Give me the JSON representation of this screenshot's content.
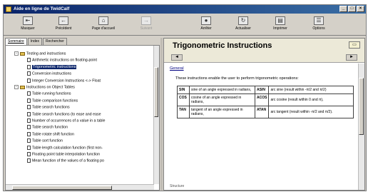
{
  "window": {
    "title": "Aide en ligne de TwidCalf"
  },
  "toolbar": [
    {
      "label": "Masquer",
      "icon": "hide-icon",
      "disabled": false
    },
    {
      "label": "Précédent",
      "icon": "back-icon",
      "disabled": false
    },
    {
      "label": "Page d'accueil",
      "icon": "home-icon",
      "disabled": false
    },
    {
      "label": "Suivant",
      "icon": "forward-icon",
      "disabled": true
    },
    {
      "label": "Arrêter",
      "icon": "stop-icon",
      "disabled": false
    },
    {
      "label": "Actualiser",
      "icon": "refresh-icon",
      "disabled": false
    },
    {
      "label": "Imprimer",
      "icon": "print-icon",
      "disabled": false
    },
    {
      "label": "Options",
      "icon": "options-icon",
      "disabled": false
    }
  ],
  "tabs": [
    "Sommaire",
    "Index",
    "Rechercher"
  ],
  "tree": [
    {
      "level": 0,
      "type": "book",
      "text": "Testing and instructions",
      "expander": "-"
    },
    {
      "level": 1,
      "type": "page",
      "text": "Arithmetic instructions on floating-point"
    },
    {
      "level": 1,
      "type": "page",
      "text": "Trigonometric instructions",
      "selected": true
    },
    {
      "level": 1,
      "type": "page",
      "text": "Conversion instructions"
    },
    {
      "level": 1,
      "type": "page",
      "text": "Integer Conversion Instructions <-> Float"
    },
    {
      "level": 0,
      "type": "book",
      "text": "Instructions on Object Tables",
      "expander": "-"
    },
    {
      "level": 1,
      "type": "page",
      "text": "Table running functions"
    },
    {
      "level": 1,
      "type": "page",
      "text": "Table comparison functions"
    },
    {
      "level": 1,
      "type": "page",
      "text": "Table search functions"
    },
    {
      "level": 1,
      "type": "page",
      "text": "Table search functions (to ease and ease"
    },
    {
      "level": 1,
      "type": "page",
      "text": "Number of occurrences of a value in a table"
    },
    {
      "level": 1,
      "type": "page",
      "text": "Table search function"
    },
    {
      "level": 1,
      "type": "page",
      "text": "Table rotate shift function"
    },
    {
      "level": 1,
      "type": "page",
      "text": "Table sort function"
    },
    {
      "level": 1,
      "type": "page",
      "text": "Table length calculation function (first non-"
    },
    {
      "level": 1,
      "type": "page",
      "text": "Floating point table interpolation function"
    },
    {
      "level": 1,
      "type": "page",
      "text": "Mean function of the values of a floating po"
    }
  ],
  "topic": {
    "title": "Trigonometric Instructions",
    "section": "General",
    "intro": "These instructions enable the user to perform trigonometric operations:",
    "rows": [
      {
        "code": "SIN",
        "desc": "sine of an angle expressed in radians,",
        "code2": "ASIN",
        "expr": "arc sine (result within -π/2 and π/2)"
      },
      {
        "code": "COS",
        "desc": "cosine of an angle expressed in radians,",
        "code2": "ACOS",
        "expr": "arc cosine (result within 0 and π),"
      },
      {
        "code": "TAN",
        "desc": "tangent of an angle expressed in radians,",
        "code2": "ATAN",
        "expr": "arc tangent (result within -π/2 and π/2)."
      }
    ],
    "next_section": "Structure"
  }
}
